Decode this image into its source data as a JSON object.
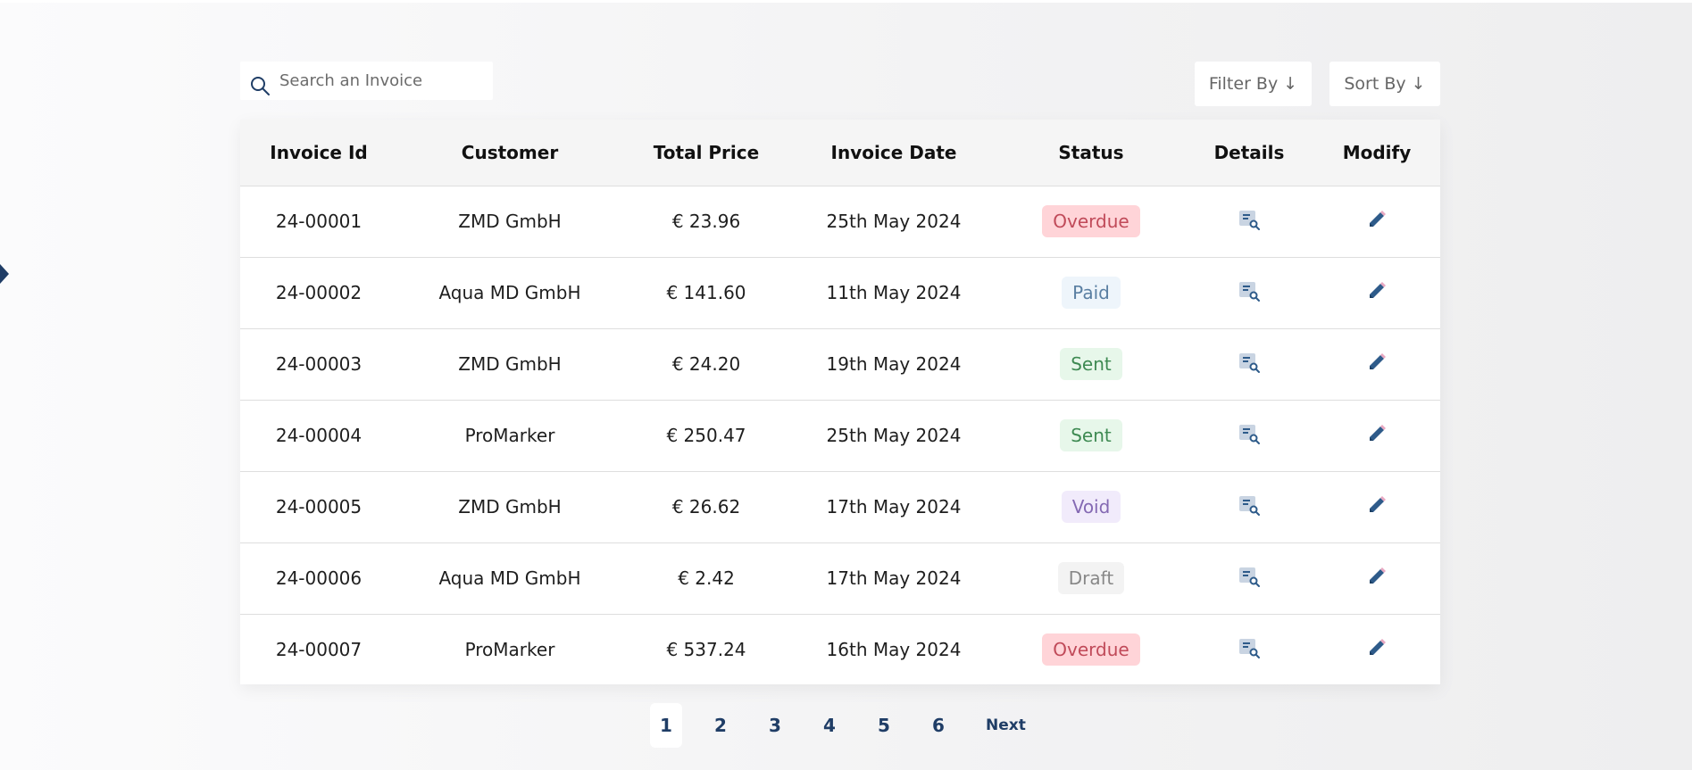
{
  "search": {
    "placeholder": "Search an Invoice",
    "icon": "search-icon"
  },
  "toolbar": {
    "filter_label": "Filter By ↓",
    "sort_label": "Sort By ↓"
  },
  "table": {
    "headers": [
      "Invoice Id",
      "Customer",
      "Total Price",
      "Invoice Date",
      "Status",
      "Details",
      "Modify"
    ],
    "rows": [
      {
        "id": "24-00001",
        "customer": "ZMD GmbH",
        "total": "€ 23.96",
        "date": "25th May 2024",
        "status": "Overdue"
      },
      {
        "id": "24-00002",
        "customer": "Aqua MD GmbH",
        "total": "€ 141.60",
        "date": "11th May 2024",
        "status": "Paid"
      },
      {
        "id": "24-00003",
        "customer": "ZMD GmbH",
        "total": "€ 24.20",
        "date": "19th May 2024",
        "status": "Sent"
      },
      {
        "id": "24-00004",
        "customer": "ProMarker",
        "total": "€ 250.47",
        "date": "25th May 2024",
        "status": "Sent"
      },
      {
        "id": "24-00005",
        "customer": "ZMD GmbH",
        "total": "€ 26.62",
        "date": "17th May 2024",
        "status": "Void"
      },
      {
        "id": "24-00006",
        "customer": "Aqua MD GmbH",
        "total": "€ 2.42",
        "date": "17th May 2024",
        "status": "Draft"
      },
      {
        "id": "24-00007",
        "customer": "ProMarker",
        "total": "€ 537.24",
        "date": "16th May 2024",
        "status": "Overdue"
      }
    ]
  },
  "pagination": {
    "pages": [
      "1",
      "2",
      "3",
      "4",
      "5",
      "6"
    ],
    "active": "1",
    "next_label": "Next"
  },
  "colors": {
    "accent": "#1f3d66",
    "icon_blue": "#2e5b8a",
    "overdue_bg": "#ffd4d8",
    "paid_bg": "#eef5fb",
    "sent_bg": "#e7f7ea",
    "void_bg": "#f1ebfb",
    "draft_bg": "#f3f3f3"
  }
}
